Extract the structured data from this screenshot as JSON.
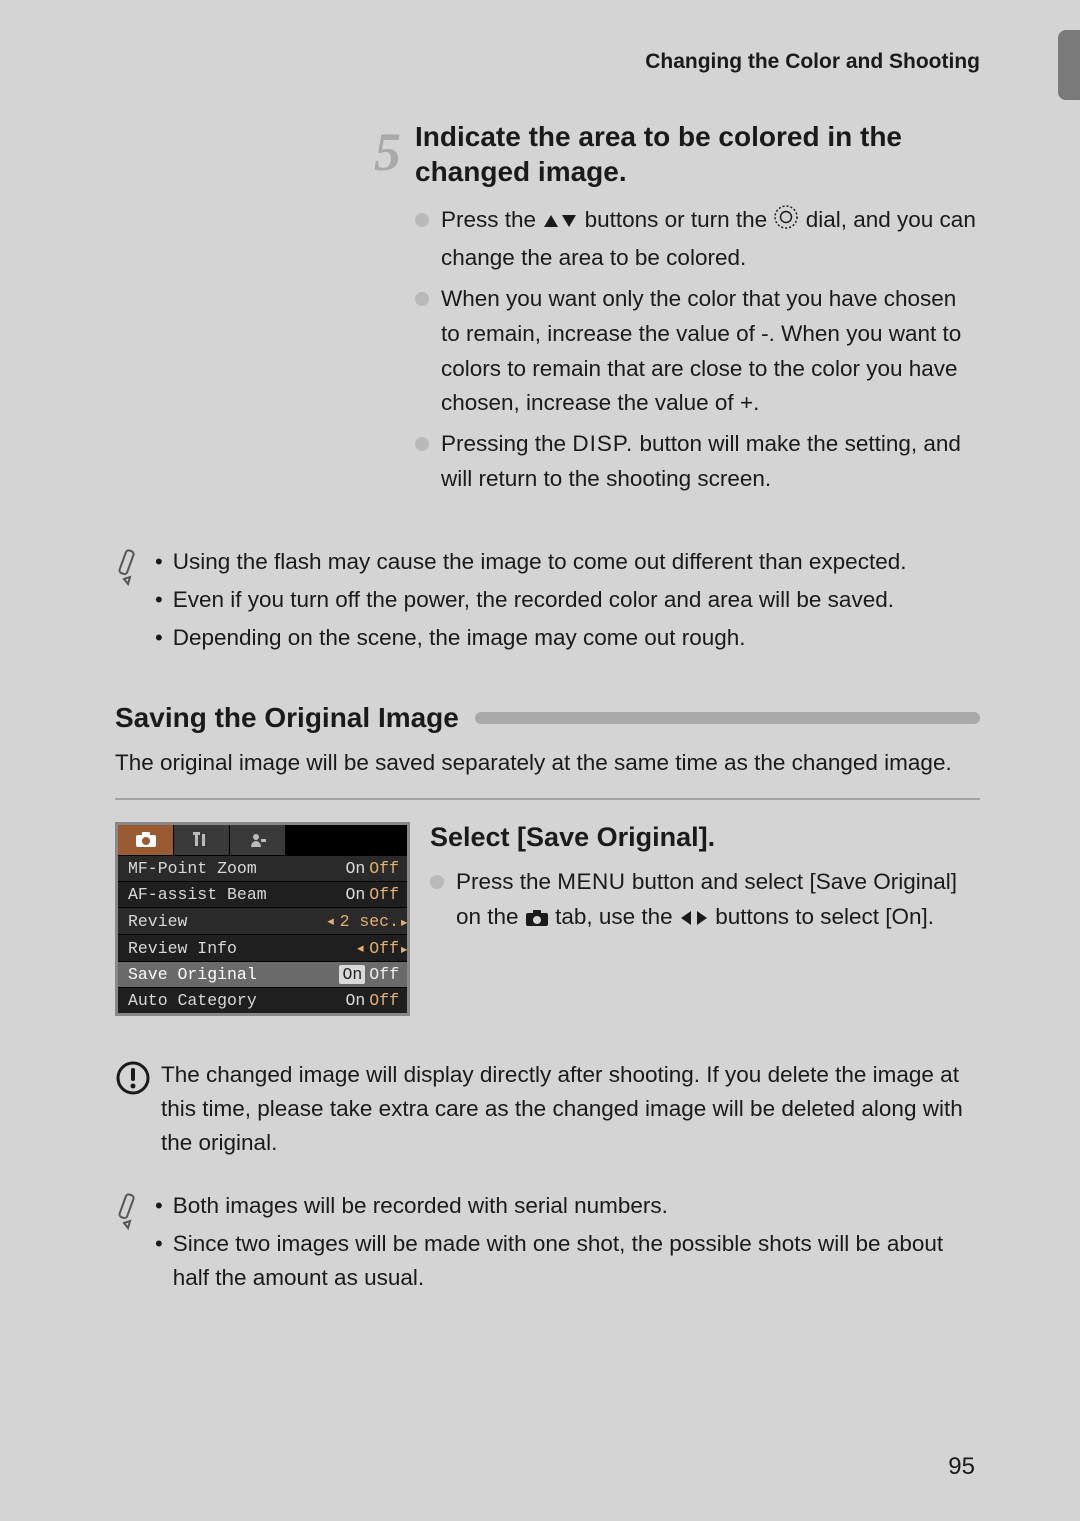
{
  "header": {
    "title": "Changing the Color and Shooting"
  },
  "step": {
    "number": "5",
    "title": "Indicate the area to be colored in the changed image.",
    "bullets": [
      {
        "pre": "Press the ",
        "mid": " buttons or turn the ",
        "post": " dial, and you can change the area to be colored."
      },
      {
        "text": "When you want only the color that you have chosen to remain, increase the value of -. When you want to colors to remain that are close to the color you have chosen, increase the value of +."
      },
      {
        "pre": "Pressing the ",
        "disp": "DISP.",
        "post": " button will make the setting, and will return to the shooting screen."
      }
    ]
  },
  "note1": {
    "items": [
      "Using the flash may cause the image to come out different than expected.",
      "Even if you turn off the power, the recorded color and area will be saved.",
      "Depending on the scene, the image may come out rough."
    ]
  },
  "section": {
    "title": "Saving the Original Image",
    "intro": "The original image will be saved separately at the same time as the changed image."
  },
  "camera_menu": {
    "items": [
      {
        "label": "MF-Point Zoom",
        "on": "On",
        "off": "Off"
      },
      {
        "label": "AF-assist Beam",
        "on": "On",
        "off": "Off"
      },
      {
        "label": "Review",
        "value": "2 sec."
      },
      {
        "label": "Review Info",
        "value": "Off"
      },
      {
        "label": "Save Original",
        "on": "On",
        "off": "Off",
        "selected": true
      },
      {
        "label": "Auto Category",
        "on": "On",
        "off": "Off"
      }
    ]
  },
  "select_block": {
    "title": "Select [Save Original].",
    "pre": "Press the ",
    "menu": "MENU",
    "mid1": " button and select [Save Original] on the ",
    "mid2": " tab, use the ",
    "post": " buttons to select [On]."
  },
  "warn": {
    "text": "The changed image will display directly after shooting. If you delete the image at this time, please take extra care as the changed image will be deleted along with the original."
  },
  "note2": {
    "items": [
      "Both images will be recorded with serial numbers.",
      "Since two images will be made with one shot, the possible shots will be about half the amount as usual."
    ]
  },
  "page_number": "95"
}
